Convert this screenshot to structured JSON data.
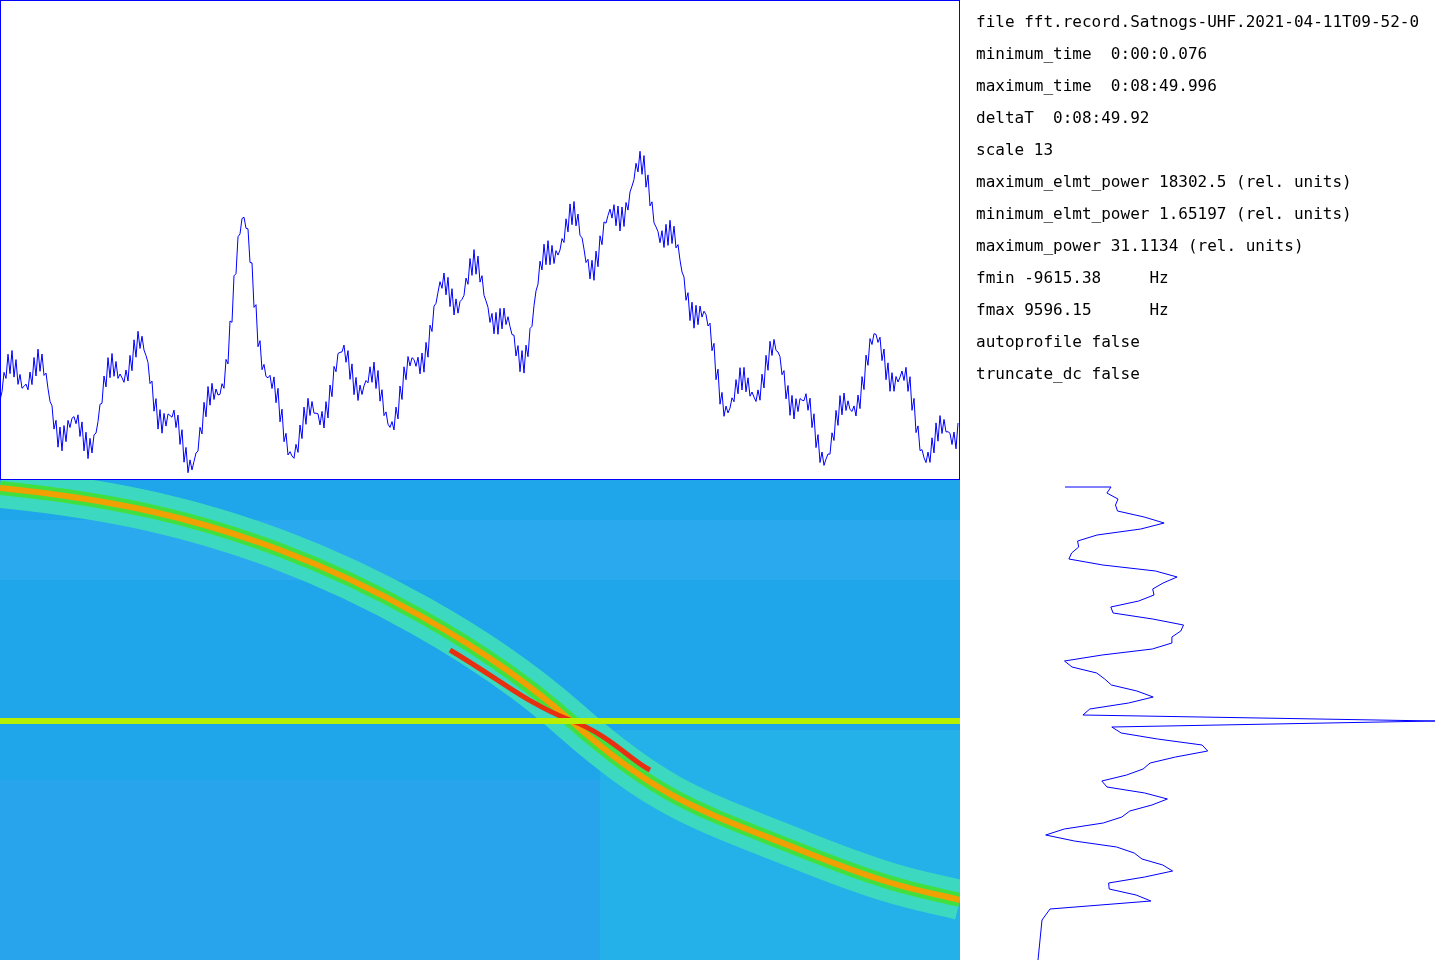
{
  "info_lines": [
    "file fft.record.Satnogs-UHF.2021-04-11T09-52-0",
    "minimum_time  0:00:0.076",
    "maximum_time  0:08:49.996",
    "deltaT  0:08:49.92",
    "scale 13",
    "maximum_elmt_power 18302.5 (rel. units)",
    "minimum_elmt_power 1.65197 (rel. units)",
    "maximum_power 31.1134 (rel. units)",
    "fmin -9615.38     Hz",
    "fmax 9596.15      Hz",
    "autoprofile false",
    "truncate_dc false"
  ]
}
